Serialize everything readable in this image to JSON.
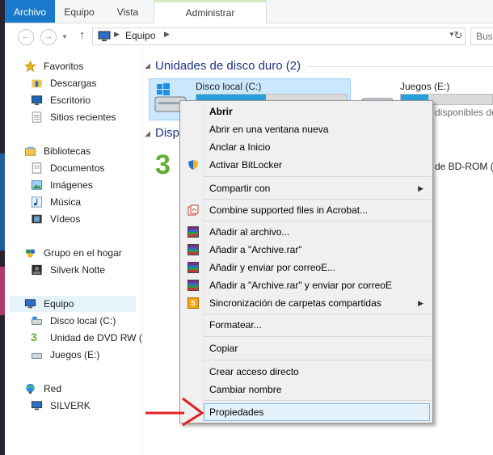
{
  "ribbon": {
    "tabs": [
      "Archivo",
      "Equipo",
      "Vista",
      "Administrar"
    ]
  },
  "address": {
    "path": "Equipo",
    "search_placeholder": "Bus"
  },
  "nav": {
    "favoritos": "Favoritos",
    "descargas": "Descargas",
    "escritorio": "Escritorio",
    "sitios": "Sitios recientes",
    "bibliotecas": "Bibliotecas",
    "documentos": "Documentos",
    "imagenes": "Imágenes",
    "musica": "Música",
    "videos": "Vídeos",
    "grupo": "Grupo en el hogar",
    "silverk_notte": "Silverk Notte",
    "equipo": "Equipo",
    "disco_c": "Disco local (C:)",
    "dvd": "Unidad de DVD RW (",
    "juegos": "Juegos (E:)",
    "red": "Red",
    "silverk": "SILVERK"
  },
  "content": {
    "section_title": "Unidades de disco duro (2)",
    "section2_partial": "Disp",
    "drive_c_label": "Disco local (C:)",
    "drive_c_used_fraction": 0.46,
    "drive_e_label": "Juegos (E:)",
    "drive_e_used_fraction": 0.3,
    "drive_e_free_partial": "disponibles de",
    "bdrom_partial": "de BD-ROM (("
  },
  "menu": {
    "abrir": "Abrir",
    "abrir_nueva": "Abrir en una ventana nueva",
    "anclar": "Anclar a Inicio",
    "bitlocker": "Activar BitLocker",
    "compartir": "Compartir con",
    "combine": "Combine supported files in Acrobat...",
    "anadir_archivo": "Añadir al archivo...",
    "anadir_rar": "Añadir a \"Archive.rar\"",
    "anadir_enviar": "Añadir y enviar por correoE...",
    "anadir_rar_enviar": "Añadir a \"Archive.rar\" y enviar por correoE",
    "sincronizacion": "Sincronización de carpetas compartidas",
    "formatear": "Formatear...",
    "copiar": "Copiar",
    "crear_acceso": "Crear acceso directo",
    "cambiar_nombre": "Cambiar nombre",
    "propiedades": "Propiedades"
  },
  "colors": {
    "accent": "#1979ca",
    "annotation_arrow": "#e02020"
  }
}
